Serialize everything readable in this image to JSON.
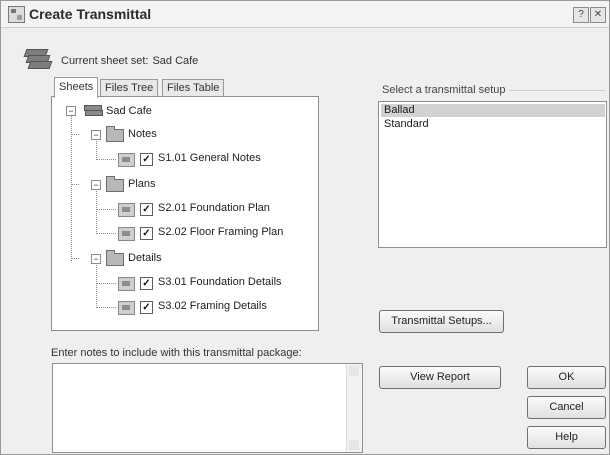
{
  "window": {
    "title": "Create Transmittal",
    "help_glyph": "?",
    "close_glyph": "✕"
  },
  "sheet_set": {
    "label": "Current sheet set:",
    "value": "Sad Cafe"
  },
  "tabs": [
    {
      "label": "Sheets",
      "active": true
    },
    {
      "label": "Files Tree",
      "active": false
    },
    {
      "label": "Files Table",
      "active": false
    }
  ],
  "tree": {
    "root": "Sad Cafe",
    "groups": [
      {
        "label": "Notes",
        "sheets": [
          "S1.01 General Notes"
        ]
      },
      {
        "label": "Plans",
        "sheets": [
          "S2.01 Foundation Plan",
          "S2.02 Floor Framing Plan"
        ]
      },
      {
        "label": "Details",
        "sheets": [
          "S3.01 Foundation Details",
          "S3.02 Framing Details"
        ]
      }
    ],
    "check_glyph": "✓",
    "collapse_glyph": "−"
  },
  "setup": {
    "label": "Select a transmittal setup",
    "items": [
      {
        "label": "Ballad",
        "selected": true
      },
      {
        "label": "Standard",
        "selected": false
      }
    ]
  },
  "buttons": {
    "transmittal_setups": "Transmittal Setups...",
    "view_report": "View Report",
    "ok": "OK",
    "cancel": "Cancel",
    "help": "Help"
  },
  "notes": {
    "label": "Enter notes to include with this transmittal package:",
    "value": ""
  }
}
